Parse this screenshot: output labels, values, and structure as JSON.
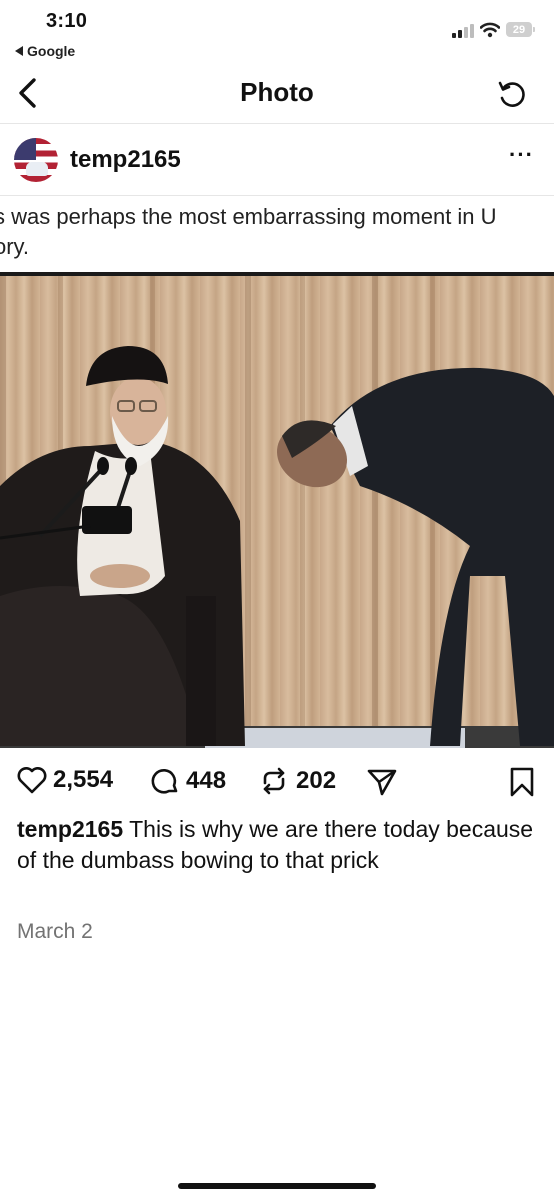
{
  "status_bar": {
    "time": "3:10",
    "back_app": "Google",
    "battery": "29"
  },
  "nav": {
    "title": "Photo"
  },
  "post": {
    "username": "temp2165",
    "caption_preview": {
      "line1": "s was perhaps the most embarrassing moment in U",
      "line2": "ory."
    },
    "likes": "2,554",
    "comments": "448",
    "reposts": "202",
    "caption_user": "temp2165",
    "caption_text": "This is why we are there today because of the dumbass bowing to that prick",
    "date": "March 2"
  },
  "icons": {
    "back": "chevron-left-icon",
    "refresh": "refresh-icon",
    "more": "more-horizontal-icon",
    "like": "heart-icon",
    "comment": "comment-icon",
    "repost": "repost-icon",
    "share": "send-icon",
    "save": "bookmark-icon"
  }
}
